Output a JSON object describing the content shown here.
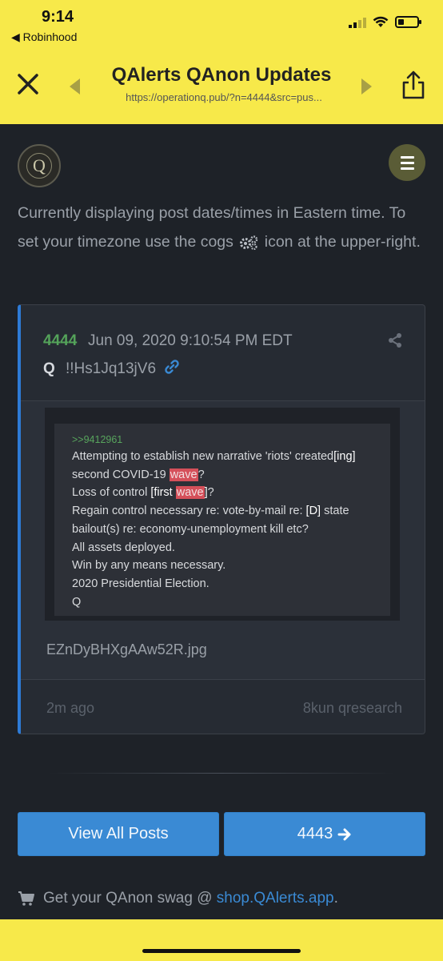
{
  "status_bar": {
    "time": "9:14",
    "back_app": "◀ Robinhood"
  },
  "browser": {
    "title": "QAlerts QAnon Updates",
    "url": "https://operationq.pub/?n=4444&src=pus..."
  },
  "site": {
    "intro_before": "Currently displaying post dates/times in Eastern time. To set your timezone use the cogs",
    "intro_after": "icon at the upper-right."
  },
  "post": {
    "number": "4444",
    "date": "Jun 09, 2020 9:10:54 PM EDT",
    "author": "Q",
    "tripcode": "!!Hs1Jq13jV6",
    "image_text": {
      "reply": ">>9412961",
      "line1_a": "Attempting to establish new narrative 'riots' created",
      "line1_b": "[ing]",
      "line2_a": "second COVID-19 ",
      "line2_hl": "wave",
      "line2_b": "?",
      "line3_a": "Loss of control ",
      "line3_b": "[first ",
      "line3_hl": "wave",
      "line3_c": "]",
      "line3_d": "?",
      "line4_a": "Regain control necessary re: vote-by-mail re: ",
      "line4_b": "[D]",
      "line4_c": " state",
      "line5": "bailout(s) re: economy-unemployment kill etc?",
      "line6": "All assets deployed.",
      "line7": "Win by any means necessary.",
      "line8": "2020 Presidential Election.",
      "line9": "Q"
    },
    "filename": "EZnDyBHXgAAw52R.jpg",
    "ago": "2m ago",
    "source": "8kun qresearch"
  },
  "buttons": {
    "view_all": "View All Posts",
    "next": "4443"
  },
  "swag": {
    "text": "Get your QAnon swag @",
    "link": "shop.QAlerts.app",
    "suffix": "."
  },
  "colors": {
    "browser_bar": "#f7e94a",
    "background": "#1e2228",
    "accent": "#3a8ad4",
    "post_number": "#54a35a",
    "highlight": "#d5505a"
  }
}
